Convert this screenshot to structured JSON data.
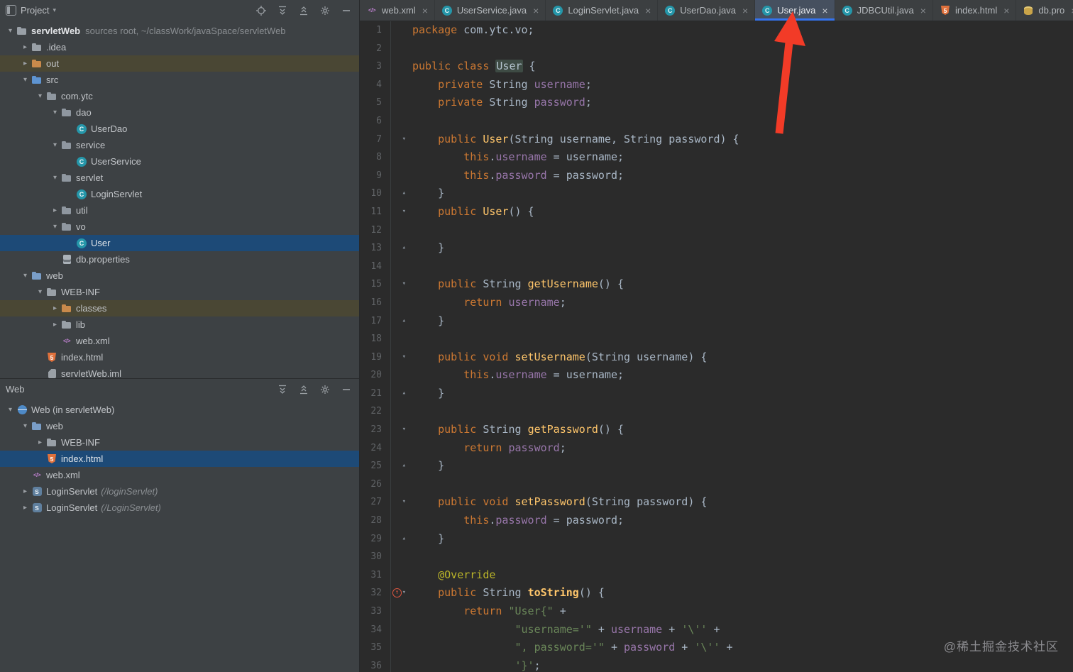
{
  "colors": {
    "accent_blue": "#3574F0",
    "selection_blue": "#1D4A77",
    "excluded_row": "#4A4734",
    "arrow_red": "#F23B27",
    "editor_background": "#2B2B2B"
  },
  "project_panel": {
    "title": "Project",
    "header_icons": [
      "locate-target",
      "expand-all",
      "collapse-all",
      "settings-gear",
      "hide-panel"
    ],
    "tree": [
      {
        "label": "servletWeb",
        "hint": "sources root, ~/classWork/javaSpace/servletWeb",
        "icon": "folder-project",
        "level": 0,
        "chevron": "expanded",
        "bold": true
      },
      {
        "label": ".idea",
        "icon": "folder",
        "level": 1,
        "chevron": "collapsed"
      },
      {
        "label": "out",
        "icon": "folder-excluded",
        "level": 1,
        "chevron": "collapsed",
        "state": "excluded"
      },
      {
        "label": "src",
        "icon": "folder-source",
        "level": 1,
        "chevron": "expanded"
      },
      {
        "label": "com.ytc",
        "icon": "package",
        "level": 2,
        "chevron": "expanded"
      },
      {
        "label": "dao",
        "icon": "package",
        "level": 3,
        "chevron": "expanded"
      },
      {
        "label": "UserDao",
        "icon": "class",
        "level": 4
      },
      {
        "label": "service",
        "icon": "package",
        "level": 3,
        "chevron": "expanded"
      },
      {
        "label": "UserService",
        "icon": "class",
        "level": 4
      },
      {
        "label": "servlet",
        "icon": "package",
        "level": 3,
        "chevron": "expanded"
      },
      {
        "label": "LoginServlet",
        "icon": "class",
        "level": 4
      },
      {
        "label": "util",
        "icon": "package",
        "level": 3,
        "chevron": "collapsed"
      },
      {
        "label": "vo",
        "icon": "package",
        "level": 3,
        "chevron": "expanded"
      },
      {
        "label": "User",
        "icon": "class",
        "level": 4,
        "state": "selected"
      },
      {
        "label": "db.properties",
        "icon": "properties",
        "level": 3
      },
      {
        "label": "web",
        "icon": "folder-web",
        "level": 1,
        "chevron": "expanded"
      },
      {
        "label": "WEB-INF",
        "icon": "folder",
        "level": 2,
        "chevron": "expanded"
      },
      {
        "label": "classes",
        "icon": "folder-excluded",
        "level": 3,
        "chevron": "collapsed",
        "state": "excluded"
      },
      {
        "label": "lib",
        "icon": "folder",
        "level": 3,
        "chevron": "collapsed"
      },
      {
        "label": "web.xml",
        "icon": "xml",
        "level": 3
      },
      {
        "label": "index.html",
        "icon": "html",
        "level": 2
      },
      {
        "label": "servletWeb.iml",
        "icon": "iml",
        "level": 2
      }
    ]
  },
  "web_panel": {
    "title": "Web",
    "header_icons": [
      "expand-all",
      "collapse-all",
      "settings-gear",
      "hide-panel"
    ],
    "tree": [
      {
        "label": "Web (in servletWeb)",
        "icon": "web-app",
        "level": 0,
        "chevron": "expanded"
      },
      {
        "label": "web",
        "icon": "folder-web",
        "level": 1,
        "chevron": "expanded"
      },
      {
        "label": "WEB-INF",
        "icon": "folder",
        "level": 2,
        "chevron": "collapsed"
      },
      {
        "label": "index.html",
        "icon": "html",
        "level": 2,
        "state": "selected"
      },
      {
        "label": "web.xml",
        "icon": "xml",
        "level": 1
      },
      {
        "label": "LoginServlet",
        "suffix": "(/loginServlet)",
        "icon": "servlet",
        "level": 1,
        "chevron": "collapsed"
      },
      {
        "label": "LoginServlet",
        "suffix": "(/LoginServlet)",
        "icon": "servlet",
        "level": 1,
        "chevron": "collapsed"
      }
    ]
  },
  "editor": {
    "close_glyph": "×",
    "tabs": [
      {
        "label": "web.xml",
        "icon": "xml",
        "active": false
      },
      {
        "label": "UserService.java",
        "icon": "class",
        "active": false
      },
      {
        "label": "LoginServlet.java",
        "icon": "class",
        "active": false
      },
      {
        "label": "UserDao.java",
        "icon": "class",
        "active": false
      },
      {
        "label": "User.java",
        "icon": "class",
        "active": true
      },
      {
        "label": "JDBCUtil.java",
        "icon": "class",
        "active": false
      },
      {
        "label": "index.html",
        "icon": "html",
        "active": false
      },
      {
        "label": "db.pro",
        "icon": "db",
        "active": false
      }
    ],
    "lines": [
      {
        "n": 1,
        "t": [
          [
            "kw",
            "package"
          ],
          [
            "pl",
            " com.ytc.vo;"
          ]
        ]
      },
      {
        "n": 2,
        "t": []
      },
      {
        "n": 3,
        "t": [
          [
            "kw",
            "public"
          ],
          [
            "pl",
            " "
          ],
          [
            "kw",
            "class"
          ],
          [
            "pl",
            " "
          ],
          [
            "cls",
            "User"
          ],
          [
            "pl",
            " {"
          ]
        ]
      },
      {
        "n": 4,
        "t": [
          [
            "pl",
            "    "
          ],
          [
            "kw",
            "private"
          ],
          [
            "pl",
            " String "
          ],
          [
            "fld",
            "username"
          ],
          [
            "pl",
            ";"
          ]
        ]
      },
      {
        "n": 5,
        "t": [
          [
            "pl",
            "    "
          ],
          [
            "kw",
            "private"
          ],
          [
            "pl",
            " String "
          ],
          [
            "fld",
            "password"
          ],
          [
            "pl",
            ";"
          ]
        ]
      },
      {
        "n": 6,
        "t": []
      },
      {
        "n": 7,
        "fold": "start",
        "t": [
          [
            "pl",
            "    "
          ],
          [
            "kw",
            "public"
          ],
          [
            "pl",
            " "
          ],
          [
            "mth",
            "User"
          ],
          [
            "pl",
            "(String username, String password) {"
          ]
        ]
      },
      {
        "n": 8,
        "t": [
          [
            "pl",
            "        "
          ],
          [
            "kw",
            "this"
          ],
          [
            "pl",
            "."
          ],
          [
            "fld",
            "username"
          ],
          [
            "pl",
            " = username;"
          ]
        ]
      },
      {
        "n": 9,
        "t": [
          [
            "pl",
            "        "
          ],
          [
            "kw",
            "this"
          ],
          [
            "pl",
            "."
          ],
          [
            "fld",
            "password"
          ],
          [
            "pl",
            " = password;"
          ]
        ]
      },
      {
        "n": 10,
        "fold": "end",
        "t": [
          [
            "pl",
            "    }"
          ]
        ]
      },
      {
        "n": 11,
        "fold": "start",
        "t": [
          [
            "pl",
            "    "
          ],
          [
            "kw",
            "public"
          ],
          [
            "pl",
            " "
          ],
          [
            "mth",
            "User"
          ],
          [
            "pl",
            "() {"
          ]
        ]
      },
      {
        "n": 12,
        "t": []
      },
      {
        "n": 13,
        "fold": "end",
        "t": [
          [
            "pl",
            "    }"
          ]
        ]
      },
      {
        "n": 14,
        "t": []
      },
      {
        "n": 15,
        "fold": "start",
        "t": [
          [
            "pl",
            "    "
          ],
          [
            "kw",
            "public"
          ],
          [
            "pl",
            " String "
          ],
          [
            "mth",
            "getUsername"
          ],
          [
            "pl",
            "() {"
          ]
        ]
      },
      {
        "n": 16,
        "t": [
          [
            "pl",
            "        "
          ],
          [
            "kw",
            "return"
          ],
          [
            "pl",
            " "
          ],
          [
            "fld",
            "username"
          ],
          [
            "pl",
            ";"
          ]
        ]
      },
      {
        "n": 17,
        "fold": "end",
        "t": [
          [
            "pl",
            "    }"
          ]
        ]
      },
      {
        "n": 18,
        "t": []
      },
      {
        "n": 19,
        "fold": "start",
        "t": [
          [
            "pl",
            "    "
          ],
          [
            "kw",
            "public"
          ],
          [
            "pl",
            " "
          ],
          [
            "kw",
            "void"
          ],
          [
            "pl",
            " "
          ],
          [
            "mth",
            "setUsername"
          ],
          [
            "pl",
            "(String username) {"
          ]
        ]
      },
      {
        "n": 20,
        "t": [
          [
            "pl",
            "        "
          ],
          [
            "kw",
            "this"
          ],
          [
            "pl",
            "."
          ],
          [
            "fld",
            "username"
          ],
          [
            "pl",
            " = username;"
          ]
        ]
      },
      {
        "n": 21,
        "fold": "end",
        "t": [
          [
            "pl",
            "    }"
          ]
        ]
      },
      {
        "n": 22,
        "t": []
      },
      {
        "n": 23,
        "fold": "start",
        "t": [
          [
            "pl",
            "    "
          ],
          [
            "kw",
            "public"
          ],
          [
            "pl",
            " String "
          ],
          [
            "mth",
            "getPassword"
          ],
          [
            "pl",
            "() {"
          ]
        ]
      },
      {
        "n": 24,
        "t": [
          [
            "pl",
            "        "
          ],
          [
            "kw",
            "return"
          ],
          [
            "pl",
            " "
          ],
          [
            "fld",
            "password"
          ],
          [
            "pl",
            ";"
          ]
        ]
      },
      {
        "n": 25,
        "fold": "end",
        "t": [
          [
            "pl",
            "    }"
          ]
        ]
      },
      {
        "n": 26,
        "t": []
      },
      {
        "n": 27,
        "fold": "start",
        "t": [
          [
            "pl",
            "    "
          ],
          [
            "kw",
            "public"
          ],
          [
            "pl",
            " "
          ],
          [
            "kw",
            "void"
          ],
          [
            "pl",
            " "
          ],
          [
            "mth",
            "setPassword"
          ],
          [
            "pl",
            "(String password) {"
          ]
        ]
      },
      {
        "n": 28,
        "t": [
          [
            "pl",
            "        "
          ],
          [
            "kw",
            "this"
          ],
          [
            "pl",
            "."
          ],
          [
            "fld",
            "password"
          ],
          [
            "pl",
            " = password;"
          ]
        ]
      },
      {
        "n": 29,
        "fold": "end",
        "t": [
          [
            "pl",
            "    }"
          ]
        ]
      },
      {
        "n": 30,
        "t": []
      },
      {
        "n": 31,
        "t": [
          [
            "pl",
            "    "
          ],
          [
            "ann",
            "@Override"
          ]
        ]
      },
      {
        "n": 32,
        "fold": "start",
        "override": true,
        "t": [
          [
            "pl",
            "    "
          ],
          [
            "kw",
            "public"
          ],
          [
            "pl",
            " String "
          ],
          [
            "mth2",
            "toString"
          ],
          [
            "pl",
            "() {"
          ]
        ]
      },
      {
        "n": 33,
        "t": [
          [
            "pl",
            "        "
          ],
          [
            "kw",
            "return"
          ],
          [
            "pl",
            " "
          ],
          [
            "str",
            "\"User{\""
          ],
          [
            "pl",
            " +"
          ]
        ]
      },
      {
        "n": 34,
        "t": [
          [
            "pl",
            "                "
          ],
          [
            "str",
            "\"username='\""
          ],
          [
            "pl",
            " + "
          ],
          [
            "fld",
            "username"
          ],
          [
            "pl",
            " + "
          ],
          [
            "str",
            "'\\''"
          ],
          [
            "pl",
            " +"
          ]
        ]
      },
      {
        "n": 35,
        "t": [
          [
            "pl",
            "                "
          ],
          [
            "str",
            "\", password='\""
          ],
          [
            "pl",
            " + "
          ],
          [
            "fld",
            "password"
          ],
          [
            "pl",
            " + "
          ],
          [
            "str",
            "'\\''"
          ],
          [
            "pl",
            " +"
          ]
        ]
      },
      {
        "n": 36,
        "t": [
          [
            "pl",
            "                "
          ],
          [
            "str",
            "'}'"
          ],
          [
            "pl",
            ";"
          ]
        ]
      }
    ]
  },
  "watermark": "@稀土掘金技术社区"
}
